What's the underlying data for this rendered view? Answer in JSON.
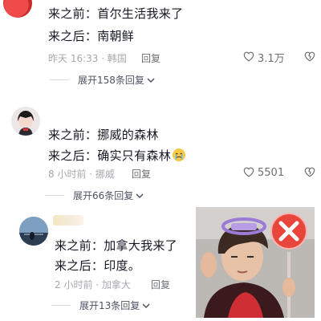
{
  "comments": [
    {
      "line1": "来之前：首尔生活我来了",
      "line2": "来之后：南朝鲜",
      "time_location": "昨天 16:33 · 韩国",
      "reply_label": "回复",
      "like_count": "3.1万",
      "expand_label": "展开158条回复"
    },
    {
      "line1": "来之前：挪威的森林",
      "line2": "来之后：确实只有森林",
      "time_location": "8 小时前 · 挪威",
      "reply_label": "回复",
      "like_count": "5501",
      "expand_label": "展开66条回复"
    },
    {
      "line1": "来之前：加拿大我来了",
      "line2": "来之后：印度。",
      "time_location": "2 小时前 · 加拿大",
      "reply_label": "回复",
      "expand_label": "展开13条回复"
    }
  ],
  "colors": {
    "x_badge": "#e8453c",
    "halo": "#9b7bd8"
  },
  "icons": [
    "heart-icon",
    "dislike-heart-icon",
    "chevron-down-icon",
    "x-circle-icon",
    "cry-emoji-icon"
  ]
}
